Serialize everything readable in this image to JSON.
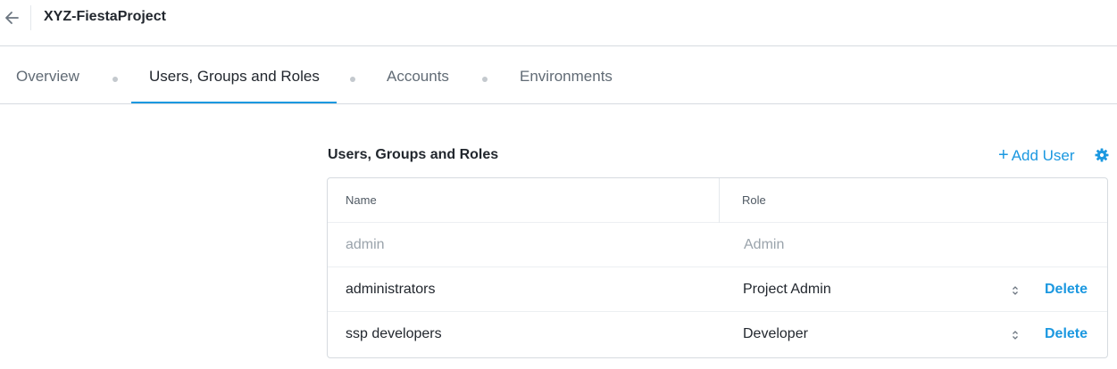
{
  "header": {
    "title": "XYZ-FiestaProject",
    "back_icon": "arrow-left-icon"
  },
  "tabs": [
    {
      "label": "Overview",
      "active": false
    },
    {
      "label": "Users, Groups and Roles",
      "active": true
    },
    {
      "label": "Accounts",
      "active": false
    },
    {
      "label": "Environments",
      "active": false
    }
  ],
  "section": {
    "title": "Users, Groups and Roles",
    "add_user_label": "Add User",
    "add_icon": "plus-icon",
    "settings_icon": "gear-icon"
  },
  "table": {
    "columns": [
      "Name",
      "Role"
    ],
    "rows": [
      {
        "name": "admin",
        "role": "Admin",
        "editable": false
      },
      {
        "name": "administrators",
        "role": "Project Admin",
        "editable": true,
        "action": "Delete"
      },
      {
        "name": "ssp developers",
        "role": "Developer",
        "editable": true,
        "action": "Delete"
      }
    ]
  },
  "colors": {
    "accent": "#1b98e0",
    "text": "#22272e",
    "muted": "#9aa3ab",
    "border": "#d6dbe0"
  }
}
